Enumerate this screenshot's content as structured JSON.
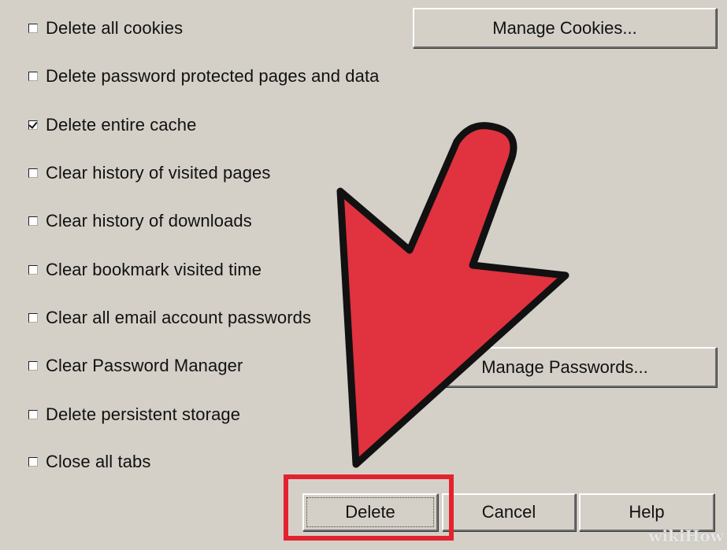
{
  "options": [
    {
      "label": "Delete all cookies",
      "checked": false
    },
    {
      "label": "Delete password protected pages and data",
      "checked": false
    },
    {
      "label": "Delete entire cache",
      "checked": true
    },
    {
      "label": "Clear history of visited pages",
      "checked": false
    },
    {
      "label": "Clear history of downloads",
      "checked": false
    },
    {
      "label": "Clear bookmark visited time",
      "checked": false
    },
    {
      "label": "Clear all email account passwords",
      "checked": false
    },
    {
      "label": "Clear Password Manager",
      "checked": false
    },
    {
      "label": "Delete persistent storage",
      "checked": false
    },
    {
      "label": "Close all tabs",
      "checked": false
    }
  ],
  "buttons": {
    "manage_cookies": "Manage Cookies...",
    "manage_passwords": "Manage Passwords...",
    "delete": "Delete",
    "cancel": "Cancel",
    "help": "Help"
  },
  "watermark": "wikiHow",
  "colors": {
    "dialog_bg": "#d4d0c8",
    "arrow": "#e0323f",
    "highlight": "#e2232f"
  },
  "icons": {
    "annotation_arrow": "red-pointer-arrow-icon"
  }
}
